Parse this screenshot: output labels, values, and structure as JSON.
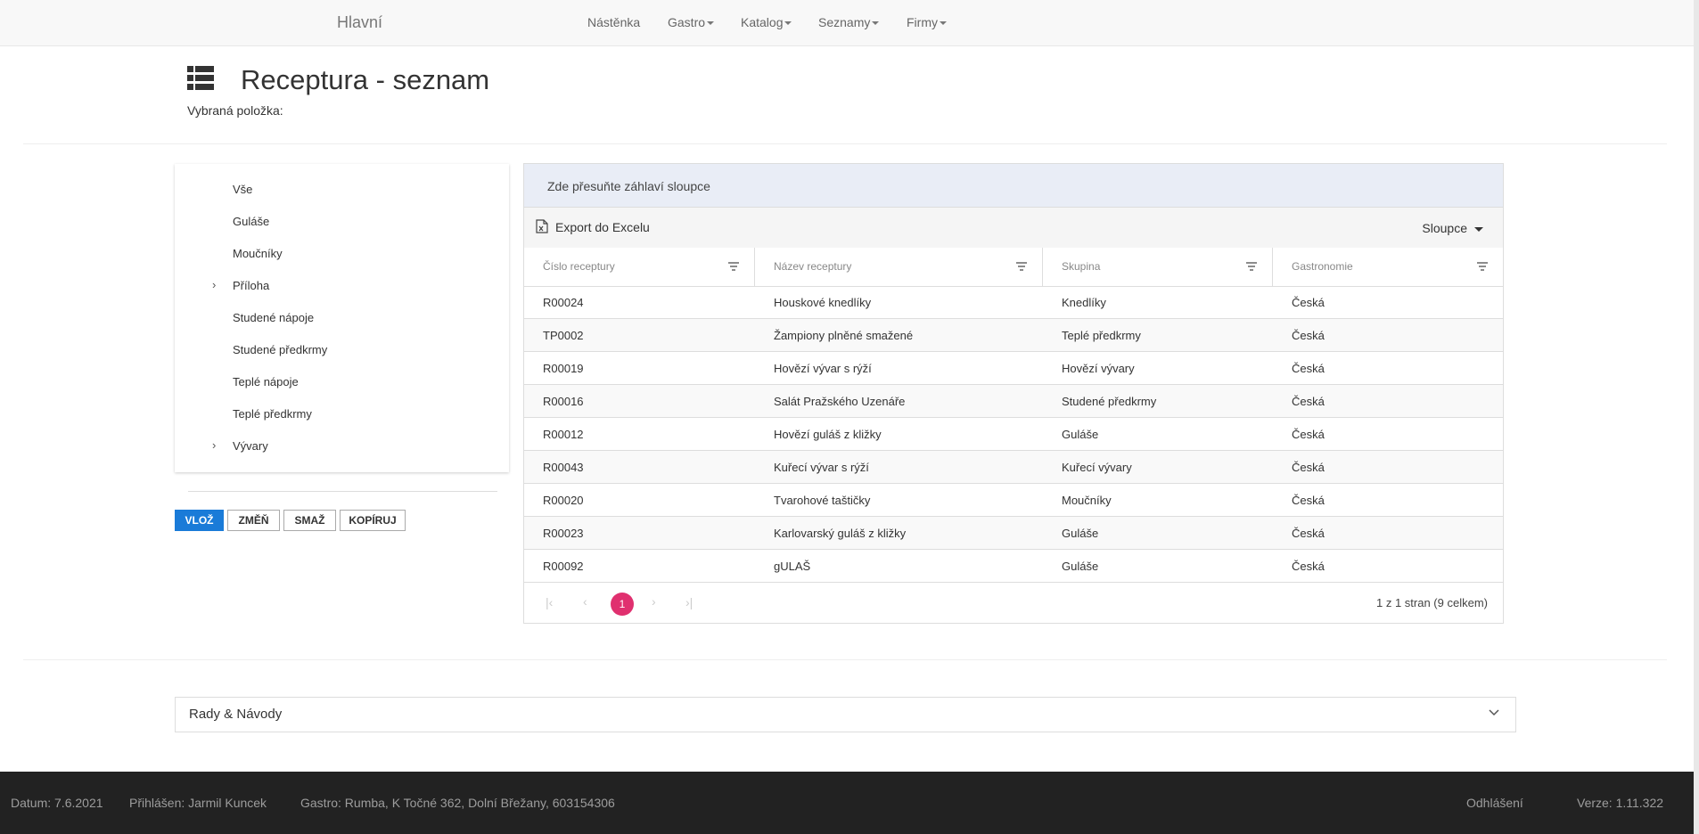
{
  "navbar": {
    "brand": "Hlavní",
    "items": [
      {
        "label": "Nástěnka",
        "dropdown": false
      },
      {
        "label": "Gastro",
        "dropdown": true
      },
      {
        "label": "Katalog",
        "dropdown": true
      },
      {
        "label": "Seznamy",
        "dropdown": true
      },
      {
        "label": "Firmy",
        "dropdown": true
      }
    ]
  },
  "page": {
    "icon": "list-icon",
    "title": "Receptura - seznam",
    "selected_label": "Vybraná položka:"
  },
  "tree": {
    "items": [
      {
        "label": "Vše",
        "expandable": false
      },
      {
        "label": "Guláše",
        "expandable": false
      },
      {
        "label": "Moučníky",
        "expandable": false
      },
      {
        "label": "Příloha",
        "expandable": true
      },
      {
        "label": "Studené nápoje",
        "expandable": false
      },
      {
        "label": "Studené předkrmy",
        "expandable": false
      },
      {
        "label": "Teplé nápoje",
        "expandable": false
      },
      {
        "label": "Teplé předkrmy",
        "expandable": false
      },
      {
        "label": "Vývary",
        "expandable": true
      }
    ]
  },
  "actions": {
    "insert": "VLOŽ",
    "change": "ZMĚŇ",
    "delete": "SMAŽ",
    "copy": "KOPÍRUJ"
  },
  "grid": {
    "group_panel_text": "Zde přesuňte záhlaví sloupce",
    "export_label": "Export do Excelu",
    "columns_label": "Sloupce",
    "headers": [
      "Číslo receptury",
      "Název receptury",
      "Skupina",
      "Gastronomie"
    ],
    "rows": [
      [
        "R00024",
        "Houskové knedlíky",
        "Knedlíky",
        "Česká"
      ],
      [
        "TP0002",
        "Žampiony plněné smažené",
        "Teplé předkrmy",
        "Česká"
      ],
      [
        "R00019",
        "Hovězí vývar s rýží",
        "Hovězí vývary",
        "Česká"
      ],
      [
        "R00016",
        "Salát Pražského Uzenáře",
        "Studené předkrmy",
        "Česká"
      ],
      [
        "R00012",
        "Hovězí guláš z kližky",
        "Guláše",
        "Česká"
      ],
      [
        "R00043",
        "Kuřecí vývar s rýží",
        "Kuřecí vývary",
        "Česká"
      ],
      [
        "R00020",
        "Tvarohové taštičky",
        "Moučníky",
        "Česká"
      ],
      [
        "R00023",
        "Karlovarský guláš z kližky",
        "Guláše",
        "Česká"
      ],
      [
        "R00092",
        "gULAŠ",
        "Guláše",
        "Česká"
      ]
    ],
    "pager": {
      "current_page": "1",
      "info": "1 z 1 stran (9 celkem)"
    }
  },
  "tips": {
    "title": "Rady & Návody"
  },
  "footer": {
    "date": "Datum: 7.6.2021",
    "user": "Přihlášen: Jarmil Kuncek",
    "gastro": "Gastro: Rumba, K Točné 362, Dolní Břežany, 603154306",
    "logout": "Odhlášení",
    "version": "Verze: 1.11.322"
  },
  "colors": {
    "primary_button": "#1a7bd8",
    "pager_active": "#e0306f",
    "footer_bg": "#222222",
    "group_panel_bg": "#e9edf6"
  }
}
